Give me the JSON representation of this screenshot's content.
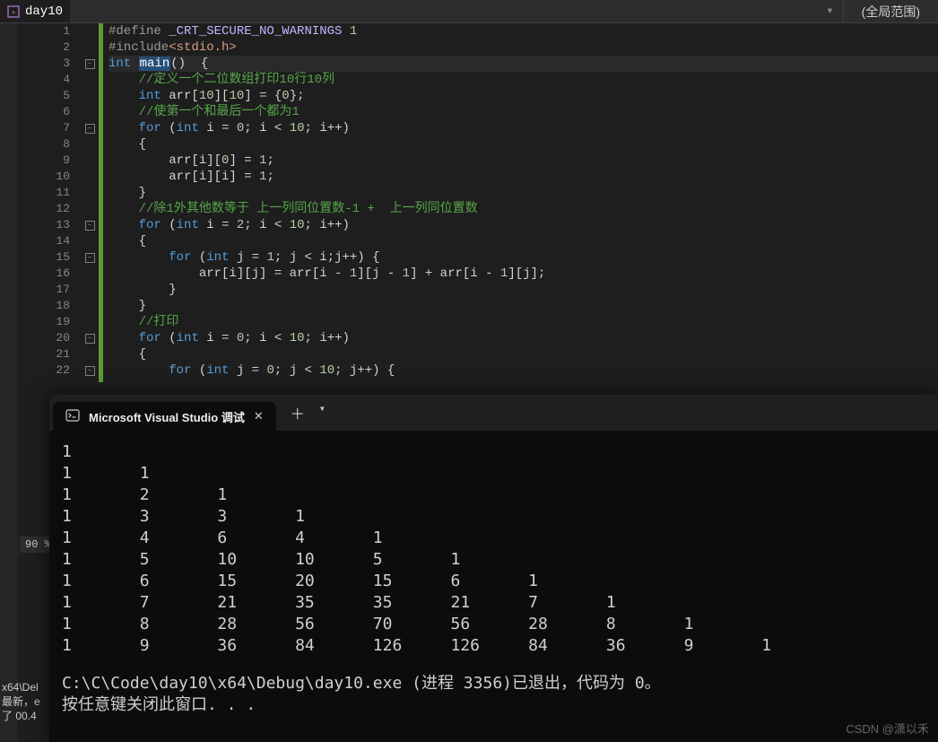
{
  "header": {
    "filename": "day10",
    "scope_label": "(全局范围)"
  },
  "status": {
    "zoom": "90 %",
    "build_msg1": "x64\\Del",
    "build_msg2": "最新，e",
    "build_msg3": "了 00.4"
  },
  "code": {
    "rows": [
      {
        "n": "1",
        "fold": "",
        "cls": "",
        "tokens": [
          [
            "tk-pre",
            "#define "
          ],
          [
            "tk-macro",
            "_CRT_SECURE_NO_WARNINGS"
          ],
          [
            "tk-num",
            " 1"
          ]
        ]
      },
      {
        "n": "2",
        "fold": "",
        "cls": "",
        "tokens": [
          [
            "tk-pre",
            "#include"
          ],
          [
            "tk-str",
            "<stdio.h>"
          ]
        ]
      },
      {
        "n": "3",
        "fold": "⊟",
        "cls": "cur-line",
        "tokens": [
          [
            "tk-kw",
            "int "
          ],
          [
            "tk-hl",
            "main"
          ],
          [
            "",
            ""
          ],
          [
            "",
            "()  {"
          ]
        ]
      },
      {
        "n": "4",
        "fold": "",
        "cls": "",
        "tokens": [
          [
            "",
            "    "
          ],
          [
            "tk-comment",
            "//定义一个二位数组打印10行10列"
          ]
        ]
      },
      {
        "n": "5",
        "fold": "",
        "cls": "",
        "tokens": [
          [
            "",
            "    "
          ],
          [
            "tk-kw",
            "int"
          ],
          [
            "",
            " arr["
          ],
          [
            "tk-num",
            "10"
          ],
          [
            "",
            "]["
          ],
          [
            "tk-num",
            "10"
          ],
          [
            "",
            "] = {"
          ],
          [
            "tk-num",
            "0"
          ],
          [
            "",
            "};"
          ]
        ]
      },
      {
        "n": "6",
        "fold": "",
        "cls": "",
        "tokens": [
          [
            "",
            "    "
          ],
          [
            "tk-comment",
            "//使第一个和最后一个都为1"
          ]
        ]
      },
      {
        "n": "7",
        "fold": "⊟",
        "cls": "",
        "tokens": [
          [
            "",
            "    "
          ],
          [
            "tk-kw",
            "for"
          ],
          [
            "",
            " ("
          ],
          [
            "tk-kw",
            "int"
          ],
          [
            "",
            " i = "
          ],
          [
            "tk-num",
            "0"
          ],
          [
            "",
            "; i < "
          ],
          [
            "tk-num",
            "10"
          ],
          [
            "",
            "; i++)"
          ]
        ]
      },
      {
        "n": "8",
        "fold": "",
        "cls": "",
        "tokens": [
          [
            "",
            "    {"
          ]
        ]
      },
      {
        "n": "9",
        "fold": "",
        "cls": "",
        "tokens": [
          [
            "",
            "        arr[i]["
          ],
          [
            "tk-num",
            "0"
          ],
          [
            "",
            "] = "
          ],
          [
            "tk-num",
            "1"
          ],
          [
            "",
            ";"
          ]
        ]
      },
      {
        "n": "10",
        "fold": "",
        "cls": "",
        "tokens": [
          [
            "",
            "        arr[i][i] = "
          ],
          [
            "tk-num",
            "1"
          ],
          [
            "",
            ";"
          ]
        ]
      },
      {
        "n": "11",
        "fold": "",
        "cls": "",
        "tokens": [
          [
            "",
            "    }"
          ]
        ]
      },
      {
        "n": "12",
        "fold": "",
        "cls": "",
        "tokens": [
          [
            "",
            "    "
          ],
          [
            "tk-comment",
            "//除1外其他数等于 上一列同位置数-1 +  上一列同位置数"
          ]
        ]
      },
      {
        "n": "13",
        "fold": "⊟",
        "cls": "",
        "tokens": [
          [
            "",
            "    "
          ],
          [
            "tk-kw",
            "for"
          ],
          [
            "",
            " ("
          ],
          [
            "tk-kw",
            "int"
          ],
          [
            "",
            " i = "
          ],
          [
            "tk-num",
            "2"
          ],
          [
            "",
            "; i < "
          ],
          [
            "tk-num",
            "10"
          ],
          [
            "",
            "; i++)"
          ]
        ]
      },
      {
        "n": "14",
        "fold": "",
        "cls": "",
        "tokens": [
          [
            "",
            "    {"
          ]
        ]
      },
      {
        "n": "15",
        "fold": "⊟",
        "cls": "",
        "tokens": [
          [
            "",
            "        "
          ],
          [
            "tk-kw",
            "for"
          ],
          [
            "",
            " ("
          ],
          [
            "tk-kw",
            "int"
          ],
          [
            "",
            " j = "
          ],
          [
            "tk-num",
            "1"
          ],
          [
            "",
            "; j < i;j++) {"
          ]
        ]
      },
      {
        "n": "16",
        "fold": "",
        "cls": "",
        "tokens": [
          [
            "",
            "            arr[i][j] = arr[i - "
          ],
          [
            "tk-num",
            "1"
          ],
          [
            "",
            "][j - "
          ],
          [
            "tk-num",
            "1"
          ],
          [
            "",
            "] + arr[i - "
          ],
          [
            "tk-num",
            "1"
          ],
          [
            "",
            "][j];"
          ]
        ]
      },
      {
        "n": "17",
        "fold": "",
        "cls": "",
        "tokens": [
          [
            "",
            "        }"
          ]
        ]
      },
      {
        "n": "18",
        "fold": "",
        "cls": "",
        "tokens": [
          [
            "",
            "    }"
          ]
        ]
      },
      {
        "n": "19",
        "fold": "",
        "cls": "",
        "tokens": [
          [
            "",
            "    "
          ],
          [
            "tk-comment",
            "//打印"
          ]
        ]
      },
      {
        "n": "20",
        "fold": "⊟",
        "cls": "",
        "tokens": [
          [
            "",
            "    "
          ],
          [
            "tk-kw",
            "for"
          ],
          [
            "",
            " ("
          ],
          [
            "tk-kw",
            "int"
          ],
          [
            "",
            " i = "
          ],
          [
            "tk-num",
            "0"
          ],
          [
            "",
            "; i < "
          ],
          [
            "tk-num",
            "10"
          ],
          [
            "",
            "; i++)"
          ]
        ]
      },
      {
        "n": "21",
        "fold": "",
        "cls": "",
        "tokens": [
          [
            "",
            "    {"
          ]
        ]
      },
      {
        "n": "22",
        "fold": "⊟",
        "cls": "",
        "tokens": [
          [
            "",
            "        "
          ],
          [
            "tk-kw",
            "for"
          ],
          [
            "",
            " ("
          ],
          [
            "tk-kw",
            "int"
          ],
          [
            "",
            " j = "
          ],
          [
            "tk-num",
            "0"
          ],
          [
            "",
            "; j < "
          ],
          [
            "tk-num",
            "10"
          ],
          [
            "",
            "; j++) {"
          ]
        ]
      }
    ]
  },
  "terminal": {
    "tab_title": "Microsoft Visual Studio 调试",
    "rows": [
      "1",
      "1       1",
      "1       2       1",
      "1       3       3       1",
      "1       4       6       4       1",
      "1       5       10      10      5       1",
      "1       6       15      20      15      6       1",
      "1       7       21      35      35      21      7       1",
      "1       8       28      56      70      56      28      8       1",
      "1       9       36      84      126     126     84      36      9       1"
    ],
    "exit_line": "C:\\C\\Code\\day10\\x64\\Debug\\day10.exe (进程 3356)已退出，代码为 0。",
    "prompt_line": "按任意键关闭此窗口. . ."
  },
  "watermark": "CSDN @潇以禾"
}
